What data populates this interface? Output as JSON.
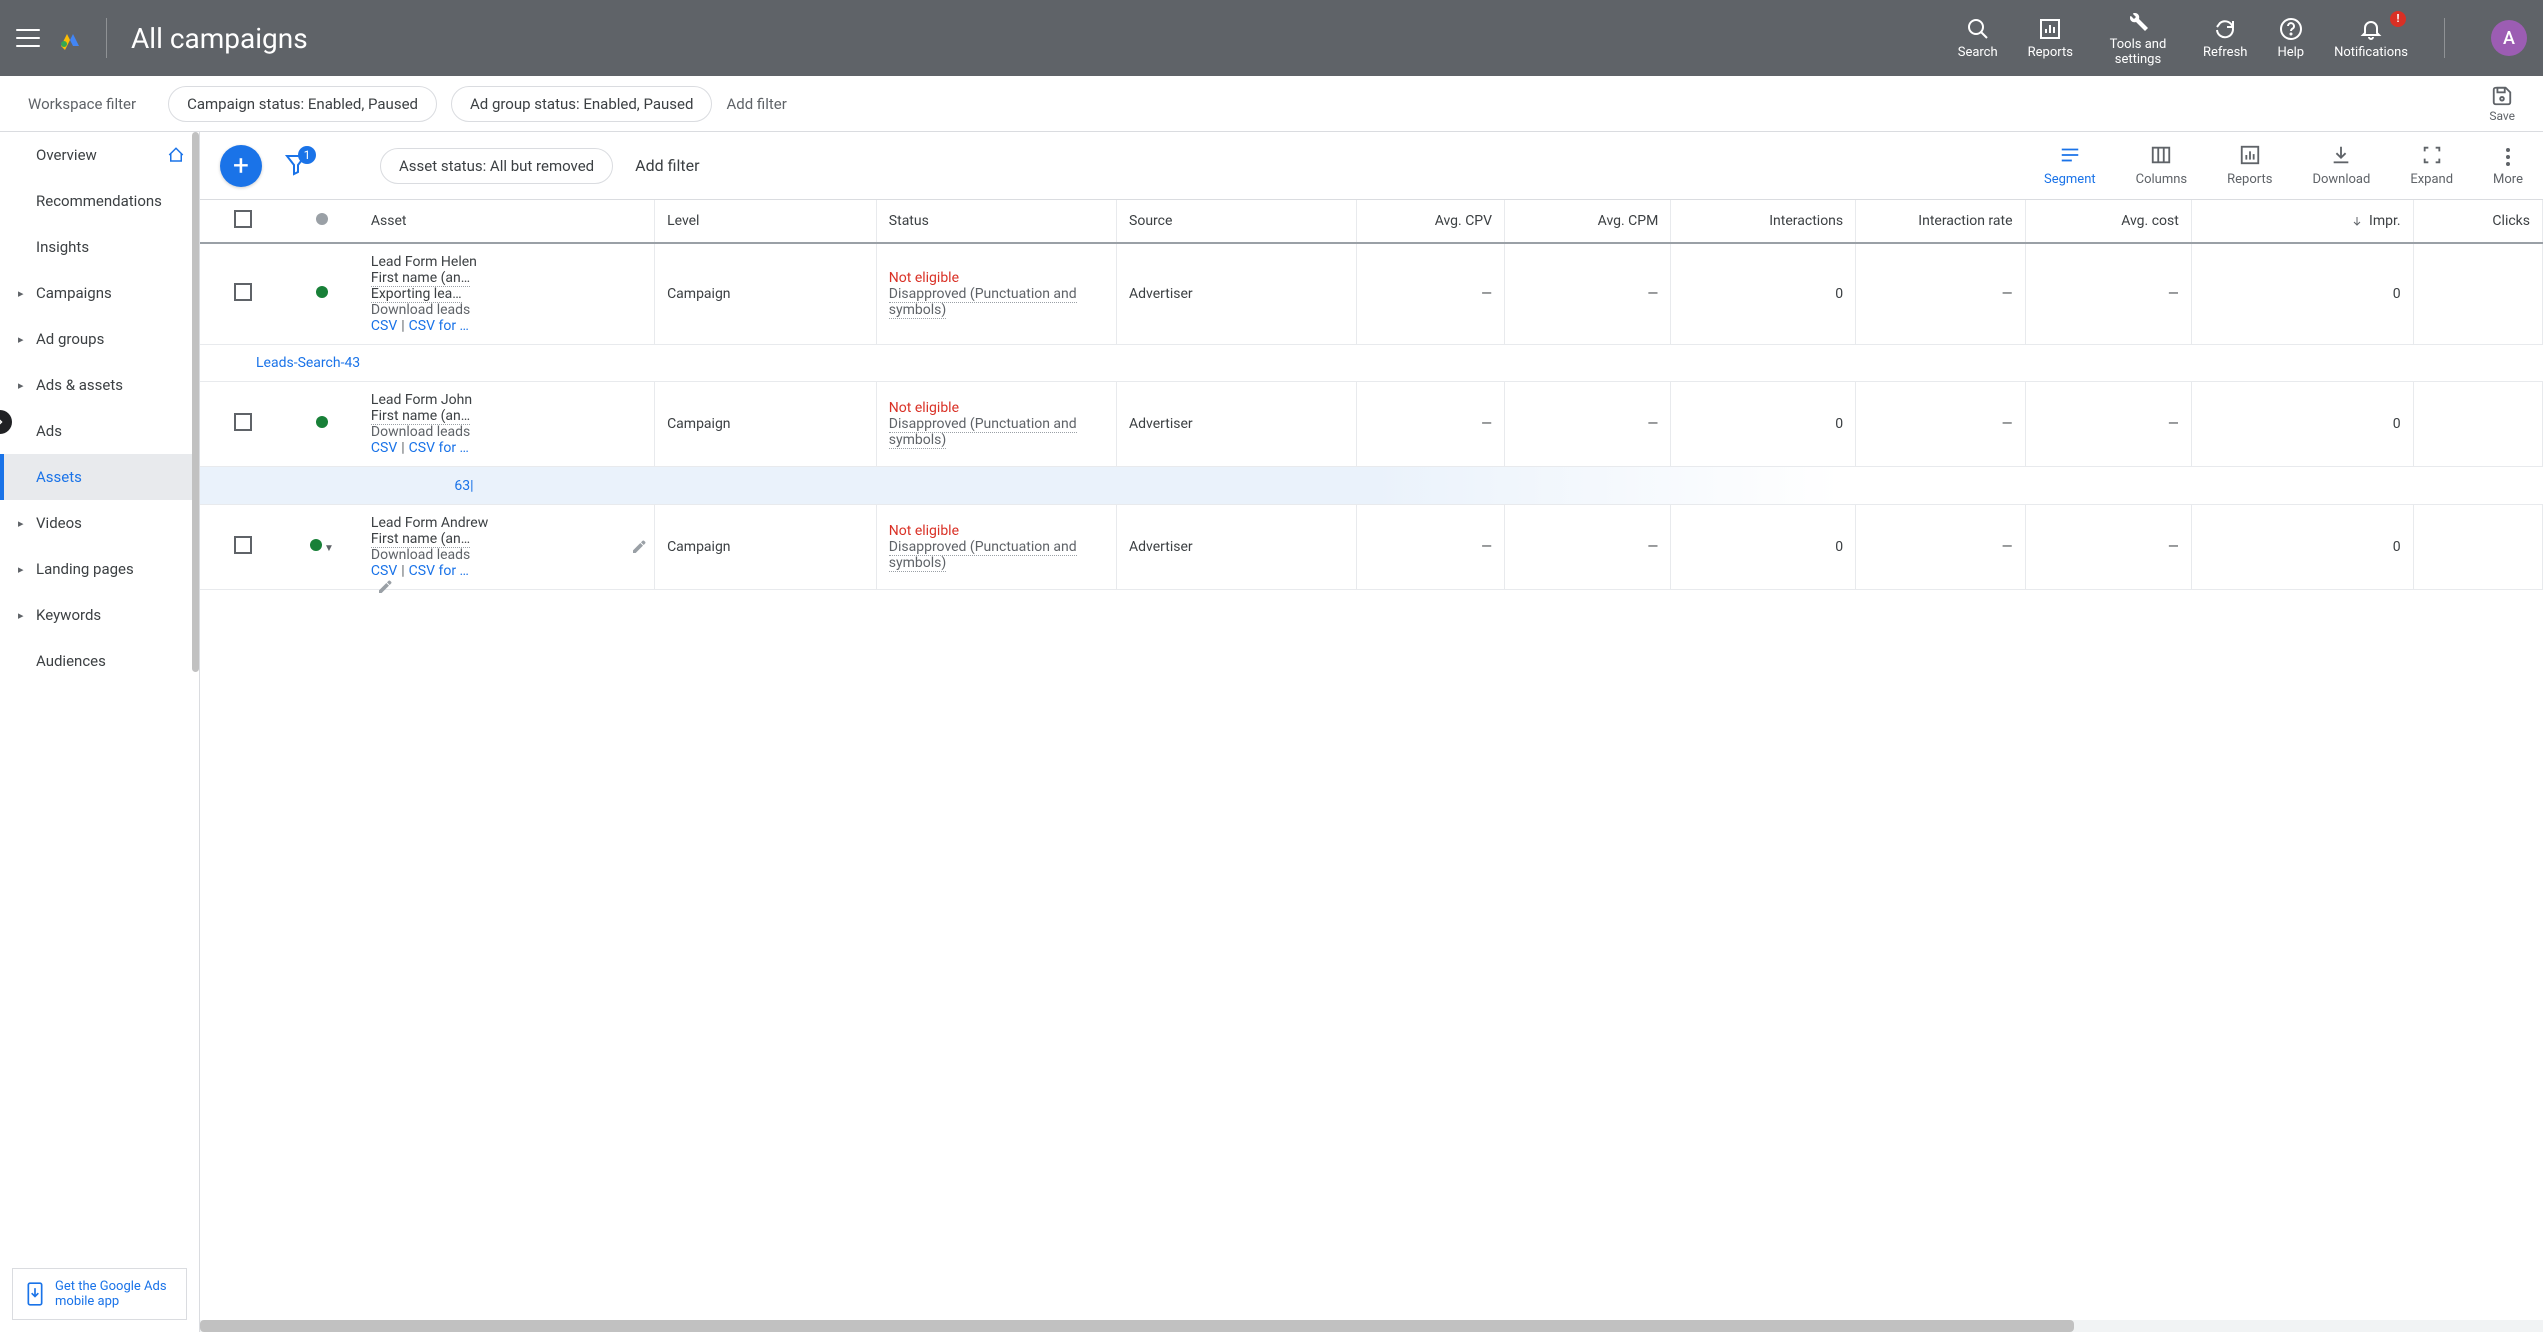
{
  "header": {
    "title": "All campaigns",
    "actions": {
      "search": "Search",
      "reports": "Reports",
      "tools": "Tools and settings",
      "refresh": "Refresh",
      "help": "Help",
      "notifications": "Notifications",
      "notif_badge": "!"
    },
    "avatar_initial": "A"
  },
  "filterbar": {
    "label": "Workspace filter",
    "chips": [
      "Campaign status: Enabled, Paused",
      "Ad group status: Enabled, Paused"
    ],
    "add": "Add filter",
    "save": "Save"
  },
  "sidebar": {
    "items": [
      {
        "label": "Overview",
        "home": true
      },
      {
        "label": "Recommendations"
      },
      {
        "label": "Insights"
      },
      {
        "label": "Campaigns",
        "arrow": true
      },
      {
        "label": "Ad groups",
        "arrow": true
      },
      {
        "label": "Ads & assets",
        "arrow": true
      },
      {
        "label": "Ads",
        "sub": true
      },
      {
        "label": "Assets",
        "sub": true,
        "active": true
      },
      {
        "label": "Videos",
        "arrow": true
      },
      {
        "label": "Landing pages",
        "arrow": true
      },
      {
        "label": "Keywords",
        "arrow": true
      },
      {
        "label": "Audiences"
      }
    ],
    "promo": "Get the Google Ads mobile app"
  },
  "toolbar": {
    "filter_count": "1",
    "asset_filter": "Asset status: All but removed",
    "add_filter": "Add filter",
    "actions": {
      "segment": "Segment",
      "columns": "Columns",
      "reports": "Reports",
      "download": "Download",
      "expand": "Expand",
      "more": "More"
    }
  },
  "table": {
    "headers": {
      "asset": "Asset",
      "level": "Level",
      "status": "Status",
      "source": "Source",
      "avg_cpv": "Avg. CPV",
      "avg_cpm": "Avg. CPM",
      "interactions": "Interactions",
      "interaction_rate": "Interaction rate",
      "avg_cost": "Avg. cost",
      "impr": "Impr.",
      "clicks": "Clicks"
    },
    "rows": [
      {
        "asset_title": "Lead Form Helen",
        "first_name": "First name (an…",
        "exporting": "Exporting lea…",
        "download": "Download leads",
        "csv": "CSV",
        "csv_for": "CSV for …",
        "level": "Campaign",
        "status_ne": "Not eligible",
        "status_dis": "Disapproved (Punctuation and symbols)",
        "source": "Advertiser",
        "avg_cpv": "—",
        "avg_cpm": "—",
        "interactions": "0",
        "interaction_rate": "—",
        "avg_cost": "—",
        "impr": "0"
      },
      {
        "group": "Leads-Search-43"
      },
      {
        "asset_title": "Lead Form John",
        "first_name": "First name (an…",
        "download": "Download leads",
        "csv": "CSV",
        "csv_for": "CSV for …",
        "level": "Campaign",
        "status_ne": "Not eligible",
        "status_dis": "Disapproved (Punctuation and symbols)",
        "source": "Advertiser",
        "avg_cpv": "—",
        "avg_cpm": "—",
        "interactions": "0",
        "interaction_rate": "—",
        "avg_cost": "—",
        "impr": "0"
      },
      {
        "group_suffix": "63|",
        "smudge": true
      },
      {
        "asset_title": "Lead Form Andrew",
        "first_name": "First name (an…",
        "download": "Download leads",
        "csv": "CSV",
        "csv_for": "CSV for …",
        "level": "Campaign",
        "status_ne": "Not eligible",
        "status_dis": "Disapproved (Punctuation and symbols)",
        "source": "Advertiser",
        "avg_cpv": "—",
        "avg_cpm": "—",
        "interactions": "0",
        "interaction_rate": "—",
        "avg_cost": "—",
        "impr": "0",
        "show_edit": true,
        "dropdown": true
      }
    ]
  }
}
